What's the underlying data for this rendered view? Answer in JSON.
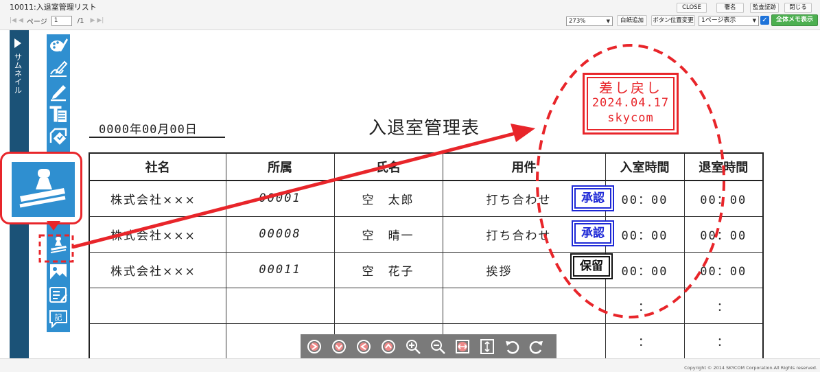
{
  "app": {
    "title": "10011:入退室管理リスト"
  },
  "pager": {
    "label": "ページ",
    "current": "1",
    "total": "/1"
  },
  "top_buttons": {
    "close": "CLOSE",
    "sign": "署名",
    "audit_trail": "監査証跡",
    "close_jp": "閉じる"
  },
  "toolbar2": {
    "zoom": "273%",
    "add_blank": "白紙追加",
    "button_position": "ボタン位置変更",
    "view_mode": "1ページ表示",
    "memo_checked": true,
    "show_all_memos": "全体メモ表示"
  },
  "sidebar": {
    "thumbnail_label": "サムネイル",
    "tools": [
      {
        "icon": "palette-icon"
      },
      {
        "icon": "freehand-pen-icon"
      },
      {
        "icon": "pen-icon"
      },
      {
        "icon": "text-icon"
      },
      {
        "icon": "shape-tool-icon"
      },
      {
        "icon": "stamp-icon"
      },
      {
        "icon": "image-icon"
      },
      {
        "icon": "memo-icon"
      },
      {
        "icon": "note-icon"
      }
    ]
  },
  "document": {
    "date": "0000年00月00日",
    "title": "入退室管理表",
    "headers": [
      "社名",
      "所属",
      "氏名",
      "用件",
      "入室時間",
      "退室時間"
    ],
    "rows": [
      {
        "company": "株式会社×××",
        "dept": "00001",
        "name": "空　太郎",
        "purpose": "打ち合わせ",
        "in": "00：00",
        "out": "00：00"
      },
      {
        "company": "株式会社×××",
        "dept": "00008",
        "name": "空　晴一",
        "purpose": "打ち合わせ",
        "in": "00：00",
        "out": "00：00"
      },
      {
        "company": "株式会社×××",
        "dept": "00011",
        "name": "空　花子",
        "purpose": "挨拶",
        "in": "00：00",
        "out": "00：00"
      },
      {
        "company": "",
        "dept": "",
        "name": "",
        "purpose": "",
        "in": "：",
        "out": "："
      },
      {
        "company": "",
        "dept": "",
        "name": "",
        "purpose": "",
        "in": "：",
        "out": "："
      }
    ],
    "stamps": {
      "approve_1": "承認",
      "approve_2": "承認",
      "hold": "保留",
      "return_line1": "差し戻し",
      "return_line2": "2024.04.17",
      "return_line3": "skycom"
    }
  },
  "viewer_controls": [
    "rotate-icon",
    "rotate-icon",
    "rotate-icon",
    "rotate-icon",
    "zoom-in-icon",
    "zoom-out-icon",
    "fit-width-icon",
    "fit-height-icon",
    "undo-icon",
    "redo-icon"
  ],
  "footer": {
    "copyright": "Copyright © 2014 SKYCOM Corporation.All Rights reserved."
  },
  "colors": {
    "annotation_red": "#e8252a",
    "toolbar_blue": "#2f8fd0",
    "thumbnail_rail": "#1b5277",
    "approve_blue": "#1d28d6",
    "memo_green": "#4caf50"
  }
}
